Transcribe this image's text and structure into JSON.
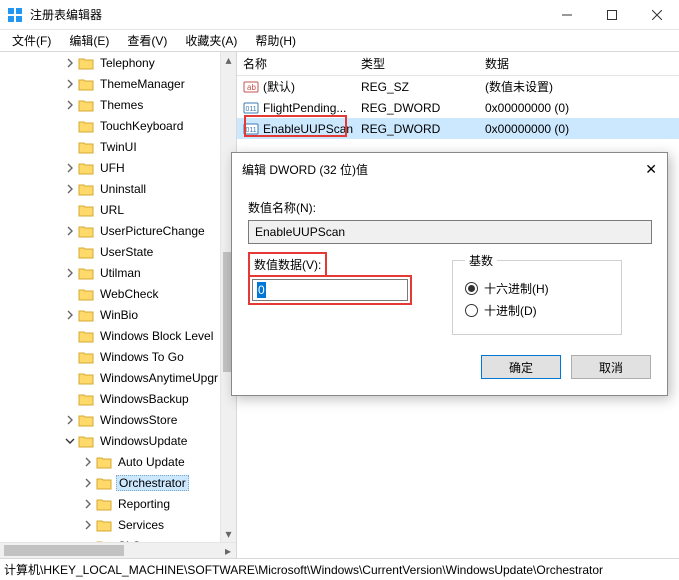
{
  "window": {
    "title": "注册表编辑器"
  },
  "menu": {
    "file": "文件(F)",
    "edit": "编辑(E)",
    "view": "查看(V)",
    "favorites": "收藏夹(A)",
    "help": "帮助(H)"
  },
  "tree": {
    "items": [
      {
        "depth": 3,
        "chev": "right",
        "label": "Telephony"
      },
      {
        "depth": 3,
        "chev": "right",
        "label": "ThemeManager"
      },
      {
        "depth": 3,
        "chev": "right",
        "label": "Themes"
      },
      {
        "depth": 3,
        "chev": "none",
        "label": "TouchKeyboard"
      },
      {
        "depth": 3,
        "chev": "none",
        "label": "TwinUI"
      },
      {
        "depth": 3,
        "chev": "right",
        "label": "UFH"
      },
      {
        "depth": 3,
        "chev": "right",
        "label": "Uninstall"
      },
      {
        "depth": 3,
        "chev": "none",
        "label": "URL"
      },
      {
        "depth": 3,
        "chev": "right",
        "label": "UserPictureChange"
      },
      {
        "depth": 3,
        "chev": "none",
        "label": "UserState"
      },
      {
        "depth": 3,
        "chev": "right",
        "label": "Utilman"
      },
      {
        "depth": 3,
        "chev": "none",
        "label": "WebCheck"
      },
      {
        "depth": 3,
        "chev": "right",
        "label": "WinBio"
      },
      {
        "depth": 3,
        "chev": "none",
        "label": "Windows Block Level"
      },
      {
        "depth": 3,
        "chev": "none",
        "label": "Windows To Go"
      },
      {
        "depth": 3,
        "chev": "none",
        "label": "WindowsAnytimeUpgr"
      },
      {
        "depth": 3,
        "chev": "none",
        "label": "WindowsBackup"
      },
      {
        "depth": 3,
        "chev": "right",
        "label": "WindowsStore"
      },
      {
        "depth": 3,
        "chev": "down",
        "label": "WindowsUpdate"
      },
      {
        "depth": 4,
        "chev": "right",
        "label": "Auto Update"
      },
      {
        "depth": 4,
        "chev": "right",
        "label": "Orchestrator",
        "selected": true
      },
      {
        "depth": 4,
        "chev": "right",
        "label": "Reporting"
      },
      {
        "depth": 4,
        "chev": "right",
        "label": "Services"
      },
      {
        "depth": 4,
        "chev": "none",
        "label": "SLS"
      }
    ]
  },
  "list": {
    "headers": {
      "name": "名称",
      "type": "类型",
      "data": "数据"
    },
    "rows": [
      {
        "icon": "string",
        "name": "(默认)",
        "type": "REG_SZ",
        "data": "(数值未设置)"
      },
      {
        "icon": "dword",
        "name": "FlightPending...",
        "type": "REG_DWORD",
        "data": "0x00000000 (0)"
      },
      {
        "icon": "dword",
        "name": "EnableUUPScan",
        "type": "REG_DWORD",
        "data": "0x00000000 (0)",
        "highlighted": true
      }
    ]
  },
  "dialog": {
    "title": "编辑 DWORD (32 位)值",
    "name_label": "数值名称(N):",
    "name_value": "EnableUUPScan",
    "data_label": "数值数据(V):",
    "data_value": "0",
    "radix_label": "基数",
    "radix_hex": "十六进制(H)",
    "radix_dec": "十进制(D)",
    "ok": "确定",
    "cancel": "取消"
  },
  "statusbar": {
    "path": "计算机\\HKEY_LOCAL_MACHINE\\SOFTWARE\\Microsoft\\Windows\\CurrentVersion\\WindowsUpdate\\Orchestrator"
  }
}
